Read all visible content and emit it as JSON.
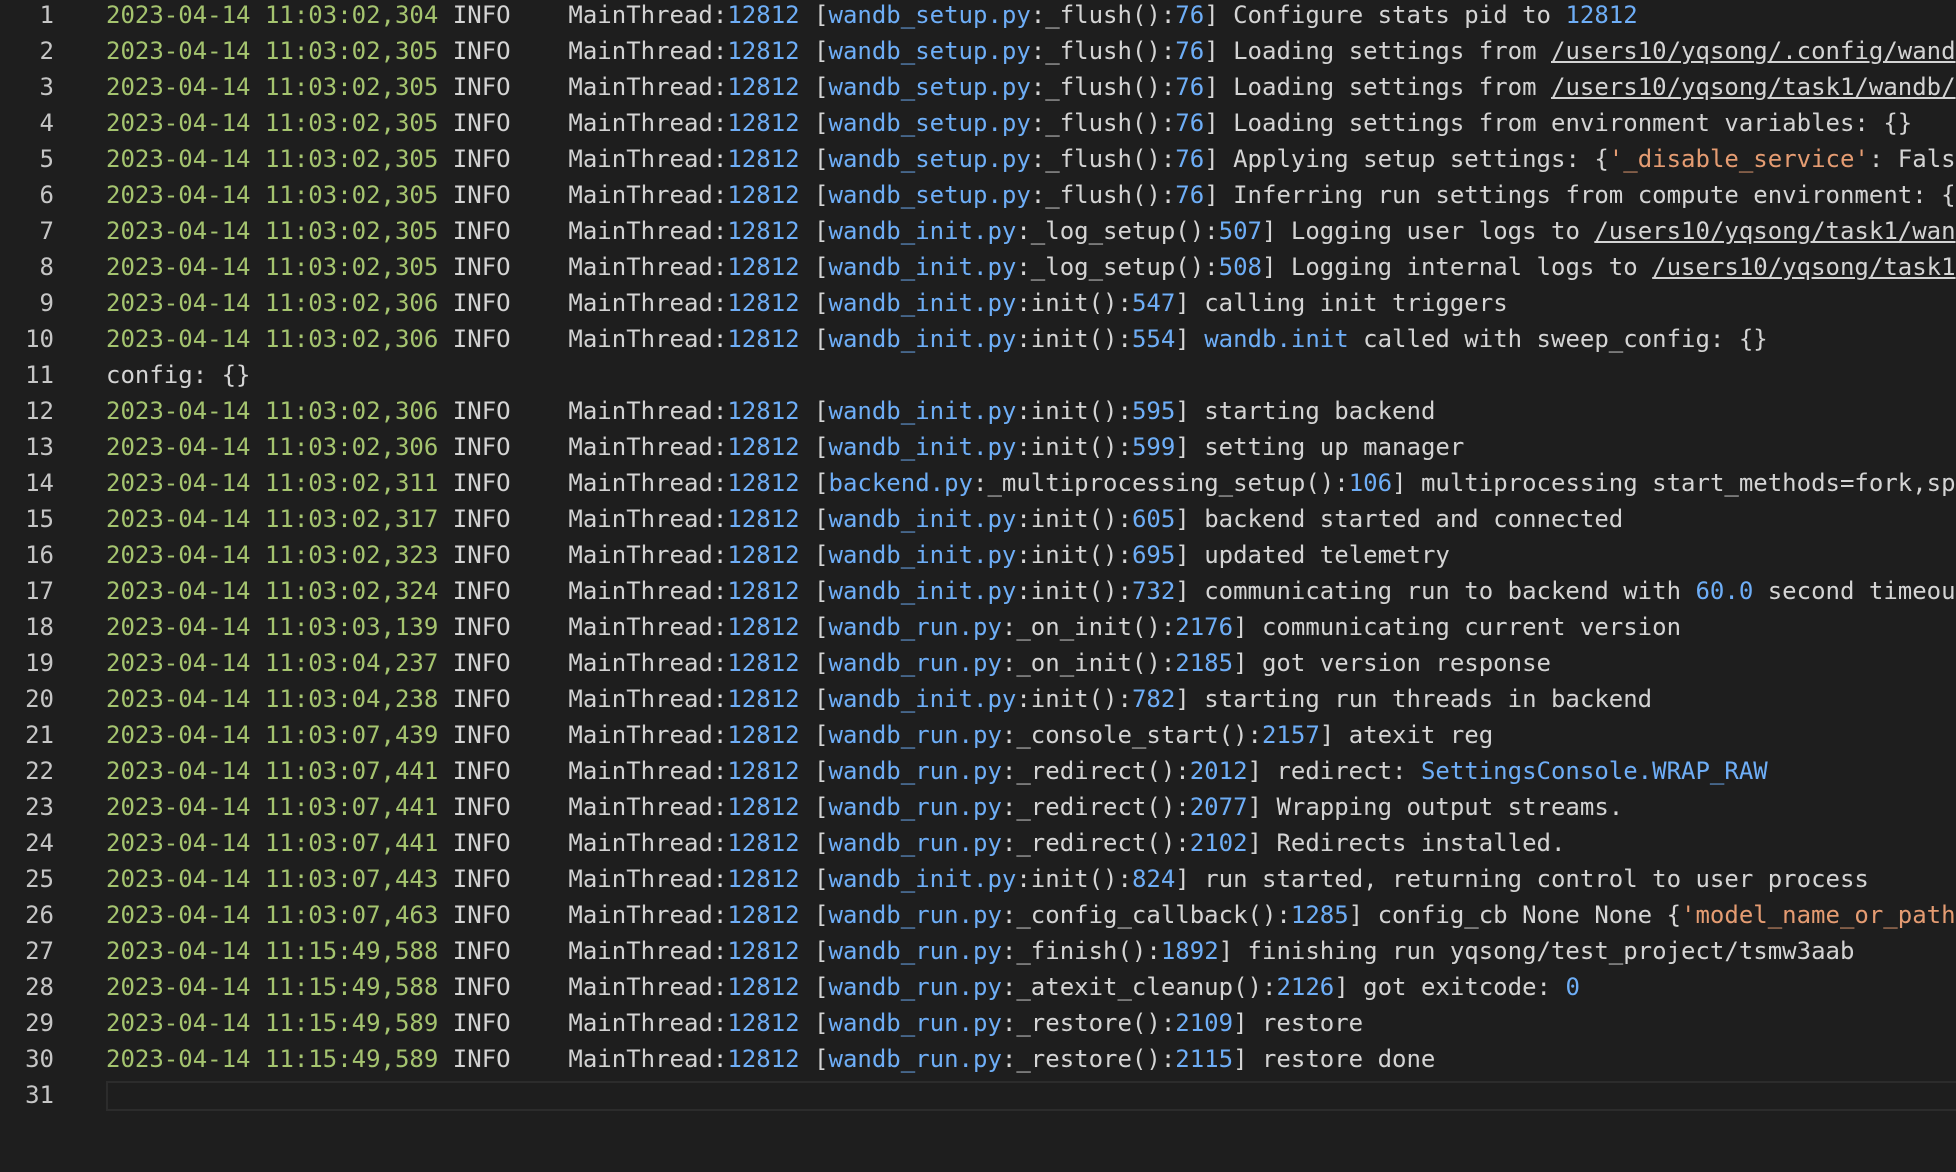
{
  "editor": {
    "lines": [
      {
        "n": "1",
        "ts": "2023-04-14 11:03:02,304",
        "lvl": "INFO",
        "thread": "MainThread:",
        "pid": "12812",
        "file": "wandb_setup.py",
        "func": ":_flush():",
        "lineno": "76",
        "msg": [
          {
            "t": "Configure stats pid to ",
            "c": "plain"
          },
          {
            "t": "12812",
            "c": "num"
          }
        ]
      },
      {
        "n": "2",
        "ts": "2023-04-14 11:03:02,305",
        "lvl": "INFO",
        "thread": "MainThread:",
        "pid": "12812",
        "file": "wandb_setup.py",
        "func": ":_flush():",
        "lineno": "76",
        "msg": [
          {
            "t": "Loading settings from ",
            "c": "plain"
          },
          {
            "t": "/users10/yqsong/.config/wand",
            "c": "path"
          }
        ]
      },
      {
        "n": "3",
        "ts": "2023-04-14 11:03:02,305",
        "lvl": "INFO",
        "thread": "MainThread:",
        "pid": "12812",
        "file": "wandb_setup.py",
        "func": ":_flush():",
        "lineno": "76",
        "msg": [
          {
            "t": "Loading settings from ",
            "c": "plain"
          },
          {
            "t": "/users10/yqsong/task1/wandb/",
            "c": "path"
          }
        ]
      },
      {
        "n": "4",
        "ts": "2023-04-14 11:03:02,305",
        "lvl": "INFO",
        "thread": "MainThread:",
        "pid": "12812",
        "file": "wandb_setup.py",
        "func": ":_flush():",
        "lineno": "76",
        "msg": [
          {
            "t": "Loading settings from environment variables: {}",
            "c": "plain"
          }
        ]
      },
      {
        "n": "5",
        "ts": "2023-04-14 11:03:02,305",
        "lvl": "INFO",
        "thread": "MainThread:",
        "pid": "12812",
        "file": "wandb_setup.py",
        "func": ":_flush():",
        "lineno": "76",
        "msg": [
          {
            "t": "Applying setup settings: {",
            "c": "plain"
          },
          {
            "t": "'_disable_service'",
            "c": "str"
          },
          {
            "t": ": Fals",
            "c": "plain"
          }
        ]
      },
      {
        "n": "6",
        "ts": "2023-04-14 11:03:02,305",
        "lvl": "INFO",
        "thread": "MainThread:",
        "pid": "12812",
        "file": "wandb_setup.py",
        "func": ":_flush():",
        "lineno": "76",
        "msg": [
          {
            "t": "Inferring run settings from compute environment: {",
            "c": "plain"
          }
        ]
      },
      {
        "n": "7",
        "ts": "2023-04-14 11:03:02,305",
        "lvl": "INFO",
        "thread": "MainThread:",
        "pid": "12812",
        "file": "wandb_init.py",
        "func": ":_log_setup():",
        "lineno": "507",
        "msg": [
          {
            "t": "Logging user logs to ",
            "c": "plain"
          },
          {
            "t": "/users10/yqsong/task1/wan",
            "c": "path"
          }
        ]
      },
      {
        "n": "8",
        "ts": "2023-04-14 11:03:02,305",
        "lvl": "INFO",
        "thread": "MainThread:",
        "pid": "12812",
        "file": "wandb_init.py",
        "func": ":_log_setup():",
        "lineno": "508",
        "msg": [
          {
            "t": "Logging internal logs to ",
            "c": "plain"
          },
          {
            "t": "/users10/yqsong/task1",
            "c": "path"
          }
        ]
      },
      {
        "n": "9",
        "ts": "2023-04-14 11:03:02,306",
        "lvl": "INFO",
        "thread": "MainThread:",
        "pid": "12812",
        "file": "wandb_init.py",
        "func": ":init():",
        "lineno": "547",
        "msg": [
          {
            "t": "calling init triggers",
            "c": "plain"
          }
        ]
      },
      {
        "n": "10",
        "ts": "2023-04-14 11:03:02,306",
        "lvl": "INFO",
        "thread": "MainThread:",
        "pid": "12812",
        "file": "wandb_init.py",
        "func": ":init():",
        "lineno": "554",
        "msg": [
          {
            "t": "wandb.init",
            "c": "num"
          },
          {
            "t": " called with sweep_config: {}",
            "c": "plain"
          }
        ]
      },
      {
        "n": "11",
        "raw": "config: {}"
      },
      {
        "n": "12",
        "ts": "2023-04-14 11:03:02,306",
        "lvl": "INFO",
        "thread": "MainThread:",
        "pid": "12812",
        "file": "wandb_init.py",
        "func": ":init():",
        "lineno": "595",
        "msg": [
          {
            "t": "starting backend",
            "c": "plain"
          }
        ]
      },
      {
        "n": "13",
        "ts": "2023-04-14 11:03:02,306",
        "lvl": "INFO",
        "thread": "MainThread:",
        "pid": "12812",
        "file": "wandb_init.py",
        "func": ":init():",
        "lineno": "599",
        "msg": [
          {
            "t": "setting up manager",
            "c": "plain"
          }
        ]
      },
      {
        "n": "14",
        "ts": "2023-04-14 11:03:02,311",
        "lvl": "INFO",
        "thread": "MainThread:",
        "pid": "12812",
        "file": "backend.py",
        "func": ":_multiprocessing_setup():",
        "lineno": "106",
        "msg": [
          {
            "t": "multiprocessing start_methods=fork,sp",
            "c": "plain"
          }
        ]
      },
      {
        "n": "15",
        "ts": "2023-04-14 11:03:02,317",
        "lvl": "INFO",
        "thread": "MainThread:",
        "pid": "12812",
        "file": "wandb_init.py",
        "func": ":init():",
        "lineno": "605",
        "msg": [
          {
            "t": "backend started and connected",
            "c": "plain"
          }
        ]
      },
      {
        "n": "16",
        "ts": "2023-04-14 11:03:02,323",
        "lvl": "INFO",
        "thread": "MainThread:",
        "pid": "12812",
        "file": "wandb_init.py",
        "func": ":init():",
        "lineno": "695",
        "msg": [
          {
            "t": "updated telemetry",
            "c": "plain"
          }
        ]
      },
      {
        "n": "17",
        "ts": "2023-04-14 11:03:02,324",
        "lvl": "INFO",
        "thread": "MainThread:",
        "pid": "12812",
        "file": "wandb_init.py",
        "func": ":init():",
        "lineno": "732",
        "msg": [
          {
            "t": "communicating run to backend with ",
            "c": "plain"
          },
          {
            "t": "60.0",
            "c": "num"
          },
          {
            "t": " second timeou",
            "c": "plain"
          }
        ]
      },
      {
        "n": "18",
        "ts": "2023-04-14 11:03:03,139",
        "lvl": "INFO",
        "thread": "MainThread:",
        "pid": "12812",
        "file": "wandb_run.py",
        "func": ":_on_init():",
        "lineno": "2176",
        "msg": [
          {
            "t": "communicating current version",
            "c": "plain"
          }
        ]
      },
      {
        "n": "19",
        "ts": "2023-04-14 11:03:04,237",
        "lvl": "INFO",
        "thread": "MainThread:",
        "pid": "12812",
        "file": "wandb_run.py",
        "func": ":_on_init():",
        "lineno": "2185",
        "msg": [
          {
            "t": "got version response",
            "c": "plain"
          }
        ]
      },
      {
        "n": "20",
        "ts": "2023-04-14 11:03:04,238",
        "lvl": "INFO",
        "thread": "MainThread:",
        "pid": "12812",
        "file": "wandb_init.py",
        "func": ":init():",
        "lineno": "782",
        "msg": [
          {
            "t": "starting run threads in backend",
            "c": "plain"
          }
        ]
      },
      {
        "n": "21",
        "ts": "2023-04-14 11:03:07,439",
        "lvl": "INFO",
        "thread": "MainThread:",
        "pid": "12812",
        "file": "wandb_run.py",
        "func": ":_console_start():",
        "lineno": "2157",
        "msg": [
          {
            "t": "atexit reg",
            "c": "plain"
          }
        ]
      },
      {
        "n": "22",
        "ts": "2023-04-14 11:03:07,441",
        "lvl": "INFO",
        "thread": "MainThread:",
        "pid": "12812",
        "file": "wandb_run.py",
        "func": ":_redirect():",
        "lineno": "2012",
        "msg": [
          {
            "t": "redirect: ",
            "c": "plain"
          },
          {
            "t": "SettingsConsole.WRAP_RAW",
            "c": "num"
          }
        ]
      },
      {
        "n": "23",
        "ts": "2023-04-14 11:03:07,441",
        "lvl": "INFO",
        "thread": "MainThread:",
        "pid": "12812",
        "file": "wandb_run.py",
        "func": ":_redirect():",
        "lineno": "2077",
        "msg": [
          {
            "t": "Wrapping output streams.",
            "c": "plain"
          }
        ]
      },
      {
        "n": "24",
        "ts": "2023-04-14 11:03:07,441",
        "lvl": "INFO",
        "thread": "MainThread:",
        "pid": "12812",
        "file": "wandb_run.py",
        "func": ":_redirect():",
        "lineno": "2102",
        "msg": [
          {
            "t": "Redirects installed.",
            "c": "plain"
          }
        ]
      },
      {
        "n": "25",
        "ts": "2023-04-14 11:03:07,443",
        "lvl": "INFO",
        "thread": "MainThread:",
        "pid": "12812",
        "file": "wandb_init.py",
        "func": ":init():",
        "lineno": "824",
        "msg": [
          {
            "t": "run started, returning control to user process",
            "c": "plain"
          }
        ]
      },
      {
        "n": "26",
        "ts": "2023-04-14 11:03:07,463",
        "lvl": "INFO",
        "thread": "MainThread:",
        "pid": "12812",
        "file": "wandb_run.py",
        "func": ":_config_callback():",
        "lineno": "1285",
        "msg": [
          {
            "t": "config_cb None None {",
            "c": "plain"
          },
          {
            "t": "'model_name_or_path",
            "c": "str"
          }
        ]
      },
      {
        "n": "27",
        "ts": "2023-04-14 11:15:49,588",
        "lvl": "INFO",
        "thread": "MainThread:",
        "pid": "12812",
        "file": "wandb_run.py",
        "func": ":_finish():",
        "lineno": "1892",
        "msg": [
          {
            "t": "finishing run yqsong/test_project/tsmw3aab",
            "c": "plain"
          }
        ]
      },
      {
        "n": "28",
        "ts": "2023-04-14 11:15:49,588",
        "lvl": "INFO",
        "thread": "MainThread:",
        "pid": "12812",
        "file": "wandb_run.py",
        "func": ":_atexit_cleanup():",
        "lineno": "2126",
        "msg": [
          {
            "t": "got exitcode: ",
            "c": "plain"
          },
          {
            "t": "0",
            "c": "num"
          }
        ]
      },
      {
        "n": "29",
        "ts": "2023-04-14 11:15:49,589",
        "lvl": "INFO",
        "thread": "MainThread:",
        "pid": "12812",
        "file": "wandb_run.py",
        "func": ":_restore():",
        "lineno": "2109",
        "msg": [
          {
            "t": "restore",
            "c": "plain"
          }
        ]
      },
      {
        "n": "30",
        "ts": "2023-04-14 11:15:49,589",
        "lvl": "INFO",
        "thread": "MainThread:",
        "pid": "12812",
        "file": "wandb_run.py",
        "func": ":_restore():",
        "lineno": "2115",
        "msg": [
          {
            "t": "restore done",
            "c": "plain"
          }
        ]
      },
      {
        "n": "31",
        "raw": "",
        "current": true
      }
    ]
  },
  "colors": {
    "background": "#1e1e1e",
    "timestamp": "#a5c46f",
    "number": "#6eaef7",
    "string": "#e59c72",
    "text": "#d4d4d4"
  }
}
